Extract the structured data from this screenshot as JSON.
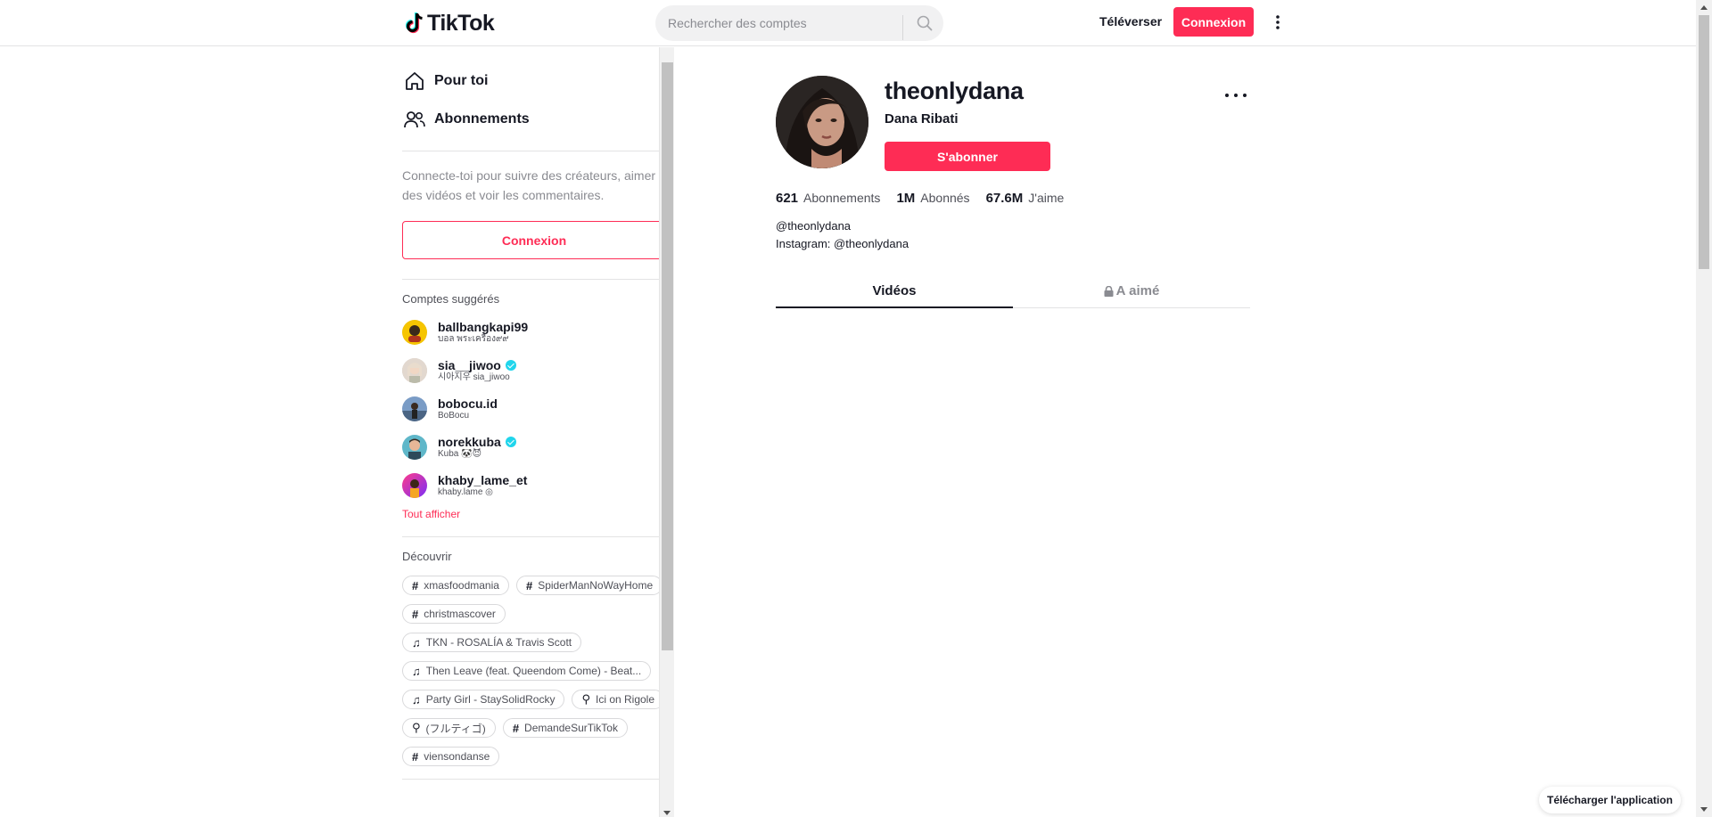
{
  "header": {
    "logo_text": "TikTok",
    "search_placeholder": "Rechercher des comptes",
    "upload_label": "Téléverser",
    "login_label": "Connexion"
  },
  "sidebar": {
    "nav": [
      {
        "label": "Pour toi",
        "icon": "home-icon"
      },
      {
        "label": "Abonnements",
        "icon": "users-icon"
      }
    ],
    "login_tip": "Connecte-toi pour suivre des créateurs, aimer des vidéos et voir les commentaires.",
    "login_button": "Connexion",
    "suggested_title": "Comptes suggérés",
    "accounts": [
      {
        "name": "ballbangkapi99",
        "sub": "บอล พระเครื่อง๙๙",
        "verified": false
      },
      {
        "name": "sia__jiwoo",
        "sub": "시아지우 sia_jiwoo",
        "verified": true
      },
      {
        "name": "bobocu.id",
        "sub": "BoBocu",
        "verified": false
      },
      {
        "name": "norekkuba",
        "sub": "Kuba 🐼😈",
        "verified": true
      },
      {
        "name": "khaby_lame_et",
        "sub": "khaby.lame ◎",
        "verified": false
      }
    ],
    "see_all": "Tout afficher",
    "discover_title": "Découvrir",
    "discover": [
      {
        "type": "hashtag",
        "label": "xmasfoodmania"
      },
      {
        "type": "hashtag",
        "label": "SpiderManNoWayHome"
      },
      {
        "type": "hashtag",
        "label": "christmascover"
      },
      {
        "type": "music",
        "label": "TKN - ROSALÍA & Travis Scott"
      },
      {
        "type": "music",
        "label": "Then Leave (feat. Queendom Come) - Beat..."
      },
      {
        "type": "music",
        "label": "Party Girl - StaySolidRocky"
      },
      {
        "type": "search",
        "label": "Ici on Rigole"
      },
      {
        "type": "search",
        "label": "(フルティゴ)"
      },
      {
        "type": "hashtag",
        "label": "DemandeSurTikTok"
      },
      {
        "type": "hashtag",
        "label": "viensondanse"
      }
    ]
  },
  "profile": {
    "username": "theonlydana",
    "nickname": "Dana Ribati",
    "follow_label": "S'abonner",
    "stats": [
      {
        "value": "621",
        "label": "Abonnements"
      },
      {
        "value": "1M",
        "label": "Abonnés"
      },
      {
        "value": "67.6M",
        "label": "J'aime"
      }
    ],
    "bio_lines": [
      "@theonlydana",
      "Instagram: @theonlydana"
    ],
    "tabs": [
      {
        "label": "Vidéos",
        "active": true,
        "locked": false
      },
      {
        "label": "A aimé",
        "active": false,
        "locked": true
      }
    ]
  },
  "download_app": "Télécharger l'application",
  "colors": {
    "brand": "#fe2c55",
    "text": "#161823",
    "muted": "#8a8b91",
    "verified": "#20d5ec"
  }
}
